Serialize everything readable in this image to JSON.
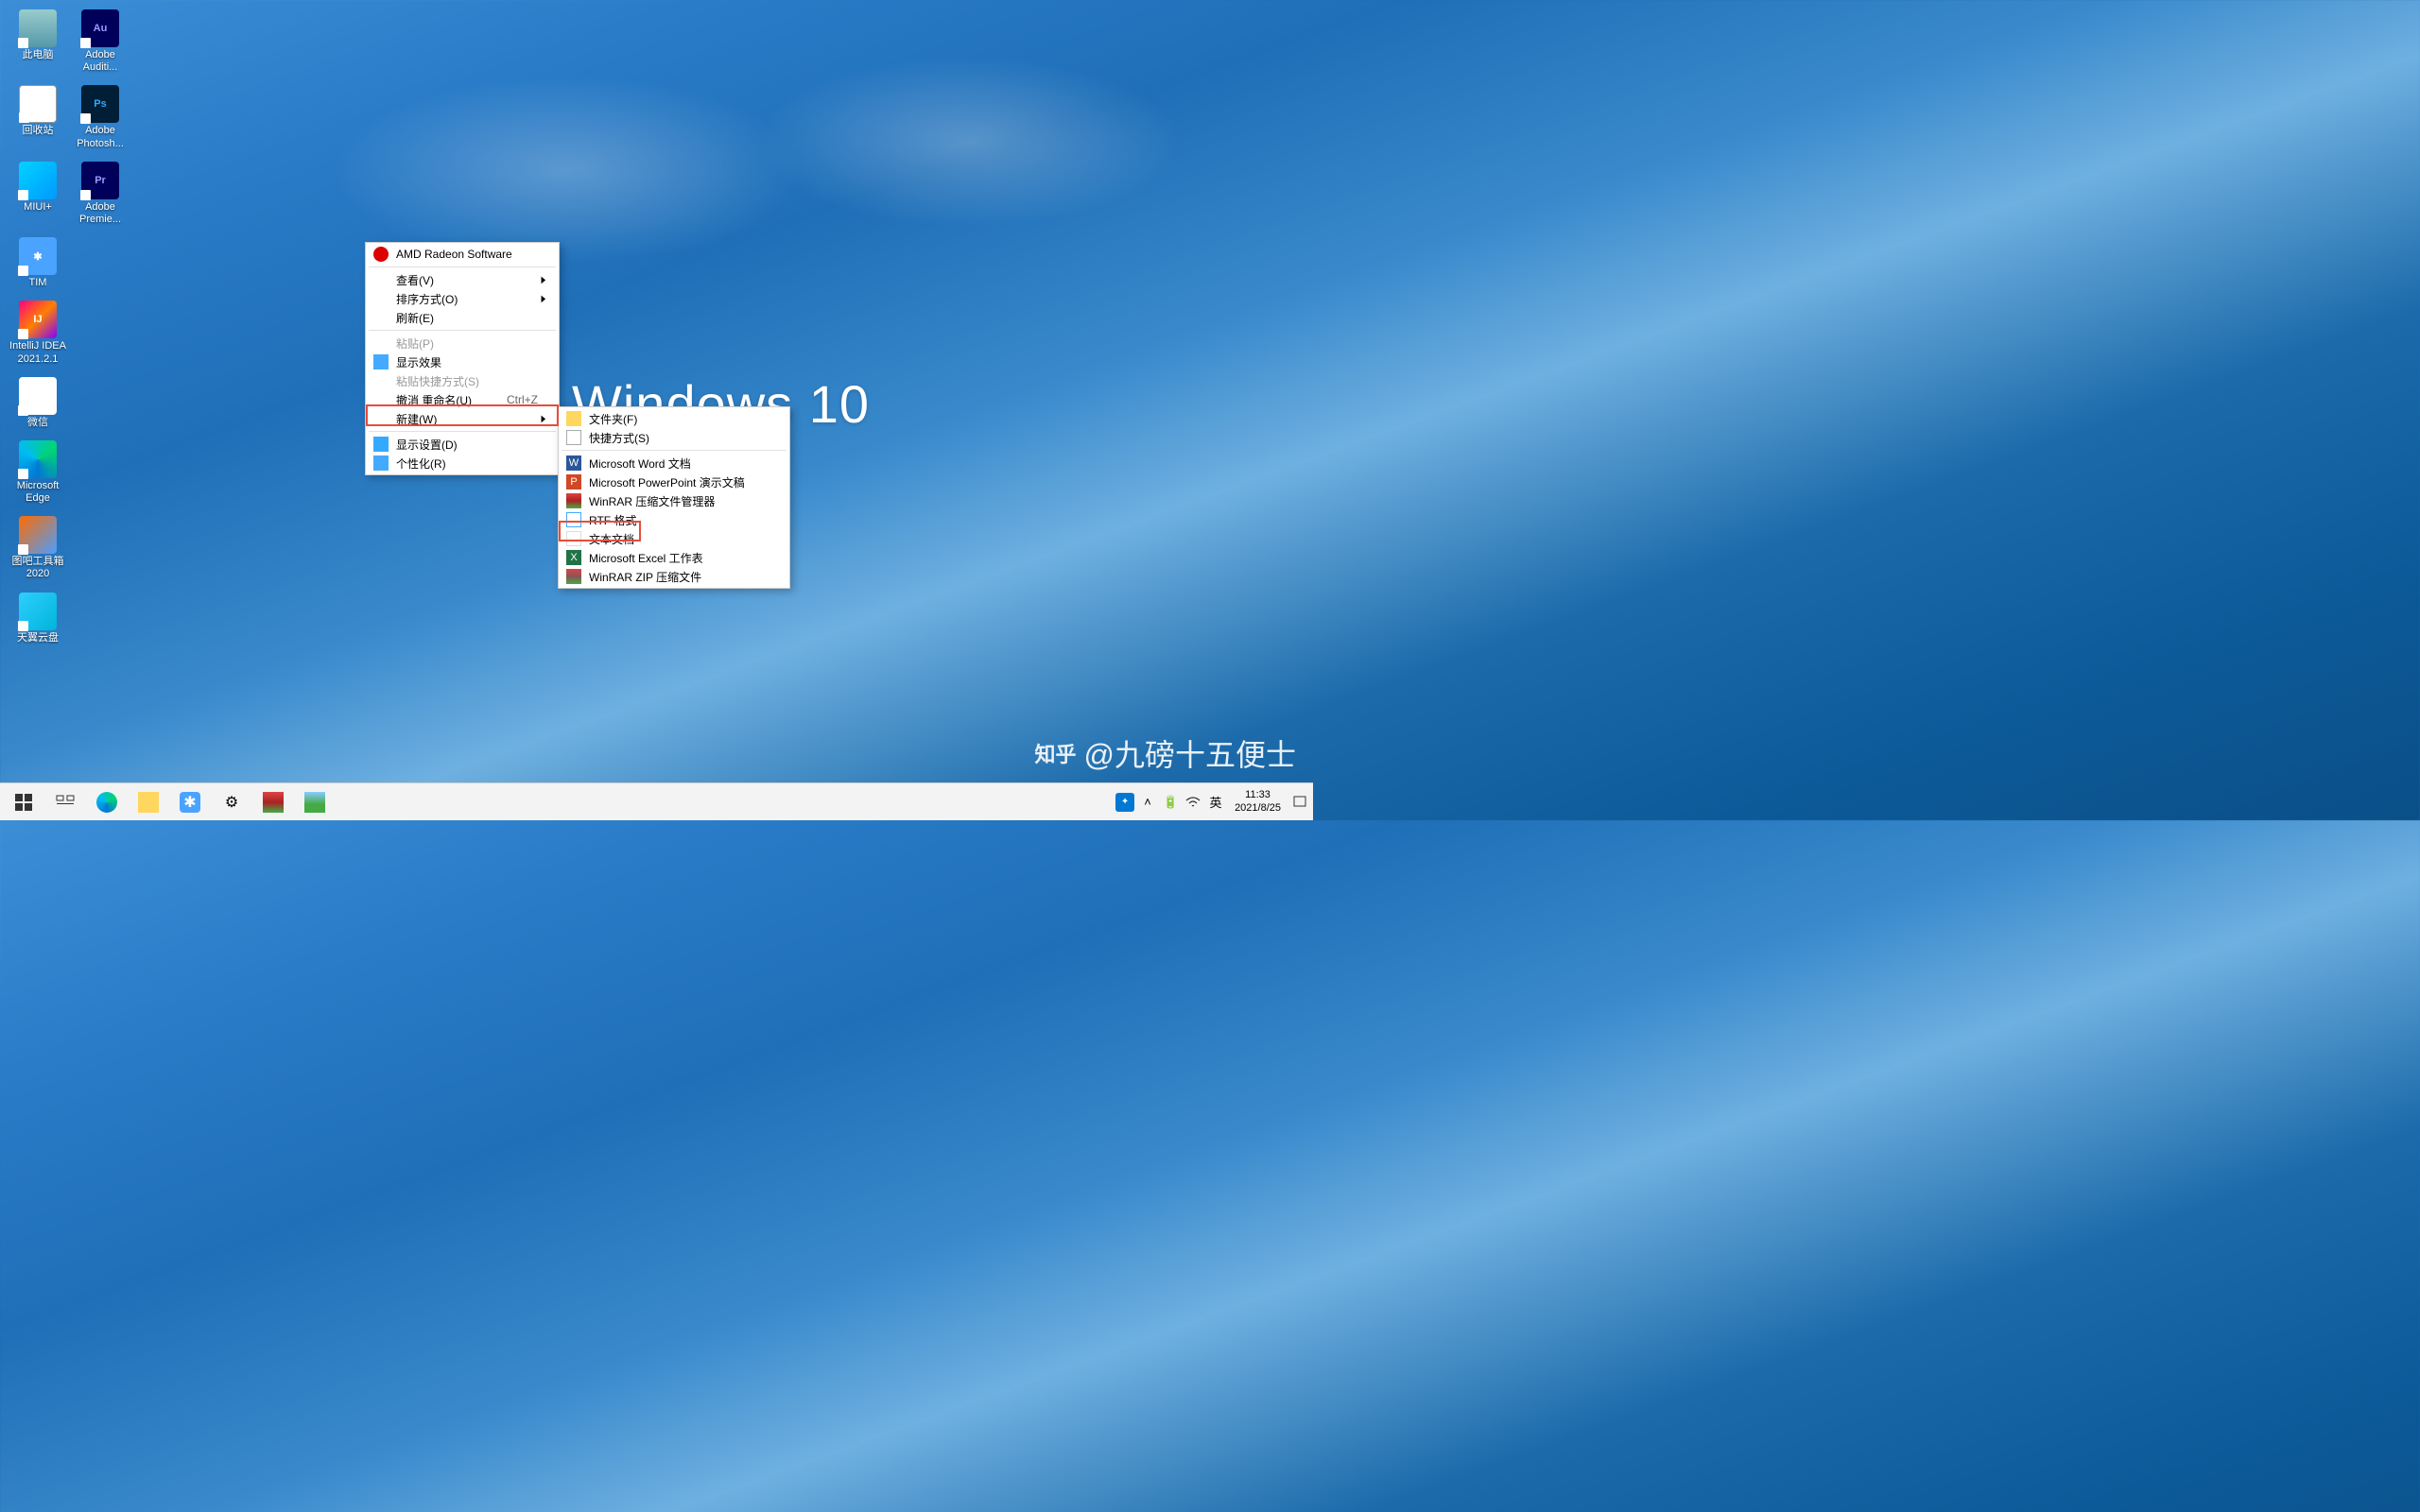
{
  "wallpaper": {
    "text": "Windows 10"
  },
  "desktop_icons": {
    "col1": [
      {
        "label": "此电脑",
        "cls": "ic-pc"
      },
      {
        "label": "回收站",
        "cls": "ic-bin"
      },
      {
        "label": "MIUI+",
        "cls": "ic-miui"
      },
      {
        "label": "TIM",
        "cls": "ic-tim",
        "glyph": "✱"
      },
      {
        "label": "IntelliJ IDEA 2021.2.1",
        "cls": "ic-ij",
        "glyph": "IJ"
      },
      {
        "label": "微信",
        "cls": "ic-wechat"
      },
      {
        "label": "Microsoft Edge",
        "cls": "ic-edge"
      },
      {
        "label": "图吧工具箱2020",
        "cls": "ic-tuba"
      },
      {
        "label": "天翼云盘",
        "cls": "ic-tianyi"
      }
    ],
    "col2": [
      {
        "label": "Adobe Auditi...",
        "cls": "ic-au",
        "glyph": "Au"
      },
      {
        "label": "Adobe Photosh...",
        "cls": "ic-ps",
        "glyph": "Ps"
      },
      {
        "label": "Adobe Premie...",
        "cls": "ic-pr",
        "glyph": "Pr"
      }
    ]
  },
  "context_menu": {
    "items": [
      {
        "label": "AMD Radeon Software",
        "icon": "ic-amd"
      },
      {
        "type": "sep"
      },
      {
        "label": "查看(V)",
        "arrow": true
      },
      {
        "label": "排序方式(O)",
        "arrow": true
      },
      {
        "label": "刷新(E)"
      },
      {
        "type": "sep"
      },
      {
        "label": "粘贴(P)",
        "disabled": true
      },
      {
        "label": "显示效果",
        "icon": "ic-disp"
      },
      {
        "label": "粘贴快捷方式(S)",
        "disabled": true
      },
      {
        "label": "撤消 重命名(U)",
        "shortcut": "Ctrl+Z"
      },
      {
        "label": "新建(W)",
        "arrow": true
      },
      {
        "type": "sep"
      },
      {
        "label": "显示设置(D)",
        "icon": "ic-monitor"
      },
      {
        "label": "个性化(R)",
        "icon": "ic-brush"
      }
    ]
  },
  "submenu": {
    "items": [
      {
        "label": "文件夹(F)",
        "icon": "ic-folder"
      },
      {
        "label": "快捷方式(S)",
        "icon": "ic-link"
      },
      {
        "type": "sep"
      },
      {
        "label": "Microsoft Word 文档",
        "icon": "ic-word",
        "glyph": "W"
      },
      {
        "label": "Microsoft PowerPoint 演示文稿",
        "icon": "ic-ppt",
        "glyph": "P"
      },
      {
        "label": "WinRAR 压缩文件管理器",
        "icon": "ic-rar"
      },
      {
        "label": "RTF 格式",
        "icon": "ic-rtf"
      },
      {
        "label": "文本文档",
        "icon": "ic-txt"
      },
      {
        "label": "Microsoft Excel 工作表",
        "icon": "ic-xls",
        "glyph": "X"
      },
      {
        "label": "WinRAR ZIP 压缩文件",
        "icon": "ic-zip"
      }
    ]
  },
  "taskbar": {
    "tray": {
      "ime": "英",
      "time": "11:33",
      "date": "2021/8/25"
    }
  },
  "watermark": {
    "logo": "知乎",
    "text": "@九磅十五便士"
  }
}
